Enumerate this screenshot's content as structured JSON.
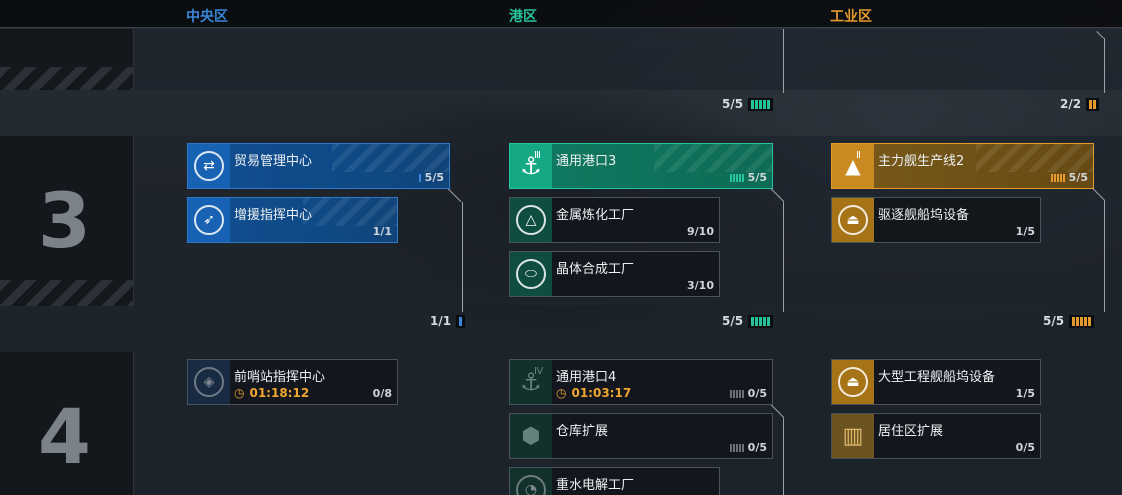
{
  "zones": {
    "central": "中央区",
    "port": "港区",
    "industry": "工业区"
  },
  "colors": {
    "central": "#3a86d8",
    "port": "#27c39c",
    "industry": "#e49a2c",
    "timer": "#f0a630"
  },
  "tiers": {
    "tier3": "3",
    "tier4": "4"
  },
  "tier2_summary": {
    "port": {
      "count": "5/5",
      "filled": 5,
      "total": 5
    },
    "industry": {
      "count": "2/2",
      "filled": 2,
      "total": 2
    }
  },
  "tier3_summary": {
    "central": {
      "count": "1/1",
      "filled": 1,
      "total": 1
    },
    "port": {
      "count": "5/5",
      "filled": 5,
      "total": 5
    },
    "industry": {
      "count": "5/5",
      "filled": 5,
      "total": 5
    }
  },
  "cards": {
    "trade_center": {
      "name": "贸易管理中心",
      "count": "5/5",
      "icon": "signal-broadcast-icon"
    },
    "reinforce_command": {
      "name": "增援指挥中心",
      "count": "1/1",
      "icon": "signal-broadcast-icon"
    },
    "port3": {
      "name": "通用港口3",
      "count": "5/5",
      "icon": "anchor-icon",
      "tier_mark": "Ⅲ"
    },
    "metal_smelting": {
      "name": "金属炼化工厂",
      "count": "9/10",
      "icon": "triangle-warning-icon"
    },
    "crystal_synthesis": {
      "name": "晶体合成工厂",
      "count": "3/10",
      "icon": "capsule-icon"
    },
    "main_ship_line2": {
      "name": "主力舰生产线2",
      "count": "5/5",
      "icon": "ship-line-icon",
      "tier_mark": "Ⅱ"
    },
    "destroyer_dock": {
      "name": "驱逐舰船坞设备",
      "count": "1/5",
      "icon": "dock-icon"
    },
    "outpost_command": {
      "name": "前哨站指挥中心",
      "count": "0/8",
      "timer": "01:18:12",
      "icon": "signal-broadcast-icon"
    },
    "port4": {
      "name": "通用港口4",
      "count": "0/5",
      "timer": "01:03:17",
      "icon": "anchor-icon",
      "tier_mark": "Ⅳ"
    },
    "warehouse_expand": {
      "name": "仓库扩展",
      "count": "0/5",
      "icon": "warehouse-icon"
    },
    "heavy_water": {
      "name": "重水电解工厂",
      "icon": "electrolysis-icon"
    },
    "engineering_dock": {
      "name": "大型工程舰船坞设备",
      "count": "1/5",
      "icon": "dock-icon"
    },
    "residential_expand": {
      "name": "居住区扩展",
      "count": "0/5",
      "icon": "building-icon"
    }
  }
}
